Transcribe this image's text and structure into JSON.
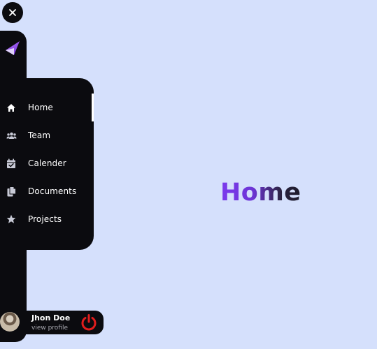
{
  "nav": {
    "items": [
      {
        "label": "Home",
        "icon": "home-icon",
        "active": true
      },
      {
        "label": "Team",
        "icon": "users-icon",
        "active": false
      },
      {
        "label": "Calender",
        "icon": "calendar-check-icon",
        "active": false
      },
      {
        "label": "Documents",
        "icon": "documents-icon",
        "active": false
      },
      {
        "label": "Projects",
        "icon": "star-icon",
        "active": false
      }
    ]
  },
  "profile": {
    "name": "Jhon Doe",
    "subtitle": "view profile"
  },
  "main": {
    "title": "Home"
  },
  "colors": {
    "background": "#d5e0fc",
    "sidebar": "#0b0b0f",
    "accent": "#7c3aed",
    "logout": "#e11d1d"
  }
}
